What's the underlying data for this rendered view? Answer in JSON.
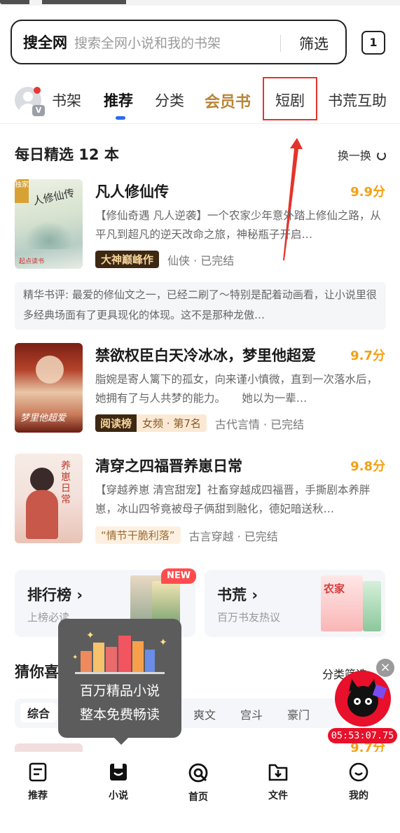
{
  "search": {
    "scope": "搜全网",
    "placeholder": "搜索全网小说和我的书架",
    "filter_label": "筛选",
    "tab_count": "1"
  },
  "tabs": [
    {
      "label": "书架"
    },
    {
      "label": "推荐",
      "active": true
    },
    {
      "label": "分类"
    },
    {
      "label": "会员书"
    },
    {
      "label": "短剧",
      "highlighted": true
    },
    {
      "label": "书荒互助"
    }
  ],
  "avatar_badge": "V",
  "daily": {
    "title": "每日精选 12 本",
    "refresh_label": "换一换"
  },
  "books": [
    {
      "title": "凡人修仙传",
      "score": "9.9分",
      "desc": "【修仙奇遇 凡人逆袭】一个农家少年意外踏上修仙之路，从平凡到超凡的逆天改命之旅，神秘瓶子开启…",
      "tag": "大神巅峰作",
      "meta": "仙侠 · 已完结",
      "cover_text": "独家",
      "cover_brand": "起点读书"
    },
    {
      "title": "禁欲权臣白天冷冰冰，梦里他超爱",
      "score": "9.7分",
      "desc": "脂婉是寄人篱下的孤女，向来谨小慎微，直到一次落水后，她拥有了与人共梦的能力。　　她以为一辈…",
      "tag_a": "阅读榜",
      "tag_b": "女频 · 第7名",
      "meta": "古代言情 · 已完结"
    },
    {
      "title": "清穿之四福晋养崽日常",
      "score": "9.8分",
      "desc": "【穿越养崽 清宫甜宠】社畜穿越成四福晋，手撕剧本养胖崽，冰山四爷竟被母子俩甜到融化，德妃暗送秋…",
      "tag": "“情节干脆利落”",
      "meta": "古言穿越 · 已完结"
    }
  ],
  "review": "精华书评: 最爱的修仙文之一，已经二刷了～特别是配着动画看，让小说里很多经典场面有了更具现化的体现。这不是那种龙傲…",
  "cards": [
    {
      "title": "排行榜",
      "subtitle": "上榜必读",
      "badge": "NEW"
    },
    {
      "title": "书荒",
      "subtitle": "百万书友热议"
    }
  ],
  "guess": {
    "title": "猜你喜",
    "filter_label": "分类筛选",
    "chips": [
      "综合",
      "爽文",
      "宫斗",
      "豪门"
    ]
  },
  "tooltip": {
    "line1": "百万精品小说",
    "line2": "整本免费畅读"
  },
  "floating": {
    "timer": "05:53:07.75"
  },
  "peek_score": "9.7分",
  "nav": [
    {
      "label": "推荐",
      "icon": "doc-icon"
    },
    {
      "label": "小说",
      "icon": "book-icon"
    },
    {
      "label": "首页",
      "icon": "home-q-icon"
    },
    {
      "label": "文件",
      "icon": "folder-download-icon"
    },
    {
      "label": "我的",
      "icon": "smile-icon"
    }
  ],
  "colors": {
    "accent_blue": "#2b6af5",
    "score_orange": "#f5a012",
    "vip_gold": "#b8863a",
    "annotation_red": "#e5342a"
  }
}
